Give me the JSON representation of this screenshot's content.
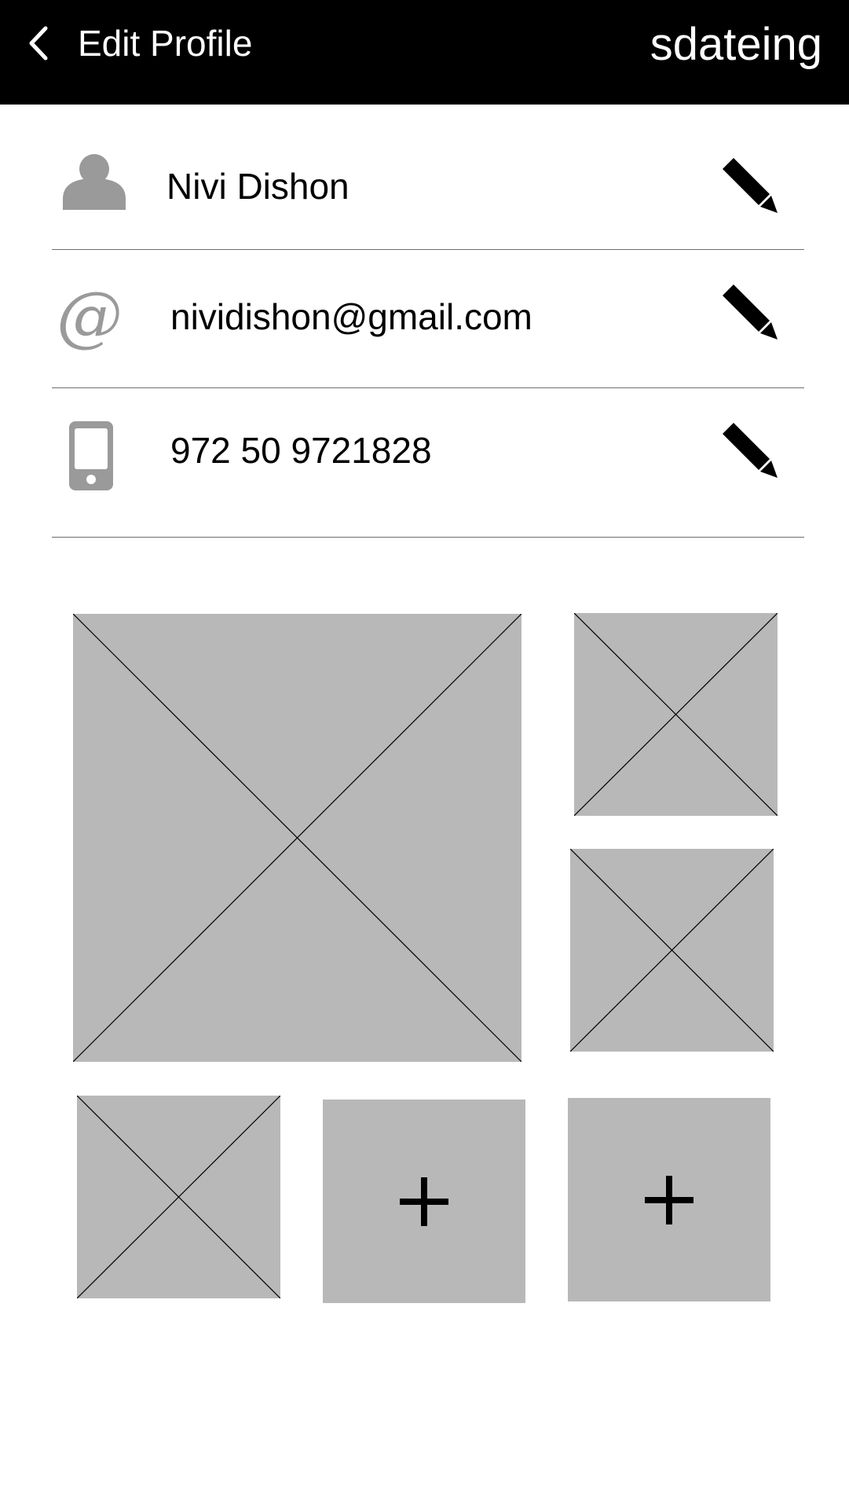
{
  "header": {
    "back_icon": "chevron-left-icon",
    "title": "Edit Profile",
    "brand": "sdateing",
    "background": "#000000",
    "text_color": "#ffffff"
  },
  "profile": {
    "name": {
      "icon": "person-icon",
      "value": "Nivi Dishon",
      "edit_icon": "pencil-icon"
    },
    "email": {
      "icon": "at-sign-icon",
      "icon_glyph": "@",
      "value": "nividishon@gmail.com",
      "edit_icon": "pencil-icon"
    },
    "phone": {
      "icon": "mobile-phone-icon",
      "value": "972 50 9721828",
      "edit_icon": "pencil-icon"
    }
  },
  "photos": {
    "filled_count": 4,
    "add_slots": 2,
    "add_icon": "plus-icon",
    "placeholder_color": "#b8b8b8"
  },
  "colors": {
    "icon_gray": "#9a9a9a",
    "divider": "#6f6f6f"
  }
}
